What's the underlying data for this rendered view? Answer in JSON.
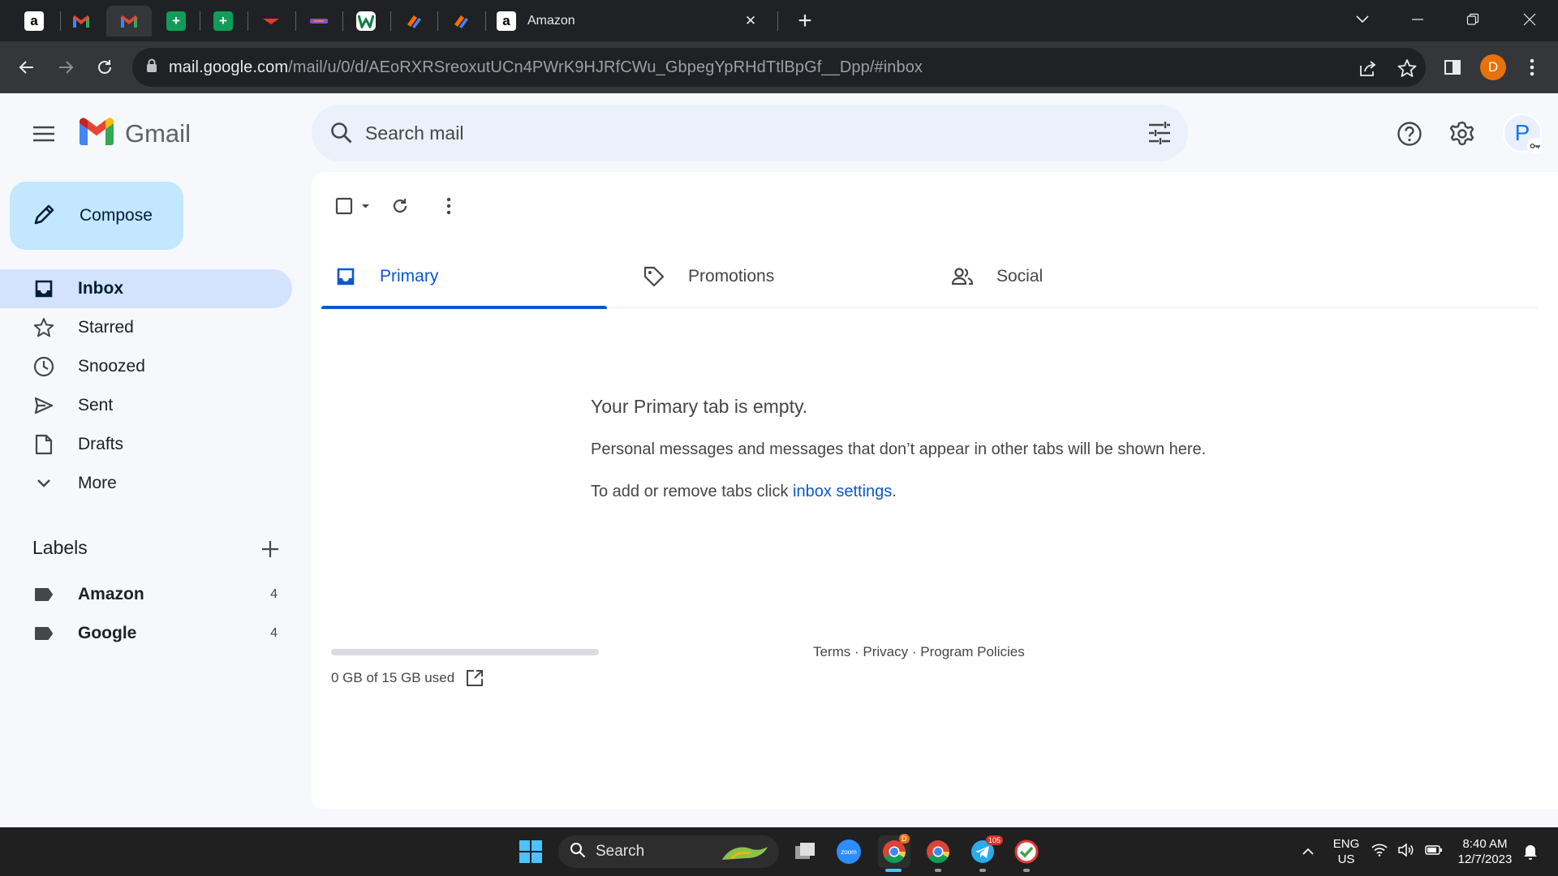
{
  "browser": {
    "active_tab_title": "Amazon",
    "url_domain": "mail.google.com",
    "url_path": "/mail/u/0/d/AEoRXRSreoxutUCn4PWrK9HJRfCWu_GbpegYpRHdTtlBpGf__Dpp/#inbox",
    "profile_initial": "D",
    "tabs": [
      {
        "icon": "amazon-icon"
      },
      {
        "icon": "gmail-icon"
      },
      {
        "icon": "gmail-icon"
      },
      {
        "icon": "google-sheets-icon"
      },
      {
        "icon": "google-sheets-icon"
      },
      {
        "icon": "site-icon"
      },
      {
        "icon": "site-icon"
      },
      {
        "icon": "w-app-icon"
      },
      {
        "icon": "task-app-icon"
      },
      {
        "icon": "task-app-icon"
      },
      {
        "icon": "amazon-icon"
      }
    ]
  },
  "gmail": {
    "logo_text": "Gmail",
    "search_placeholder": "Search mail",
    "account_initial": "P",
    "compose_label": "Compose",
    "nav": [
      {
        "label": "Inbox",
        "icon": "inbox-icon",
        "active": true
      },
      {
        "label": "Starred",
        "icon": "star-icon"
      },
      {
        "label": "Snoozed",
        "icon": "clock-icon"
      },
      {
        "label": "Sent",
        "icon": "send-icon"
      },
      {
        "label": "Drafts",
        "icon": "draft-icon"
      },
      {
        "label": "More",
        "icon": "chevron-down-icon"
      }
    ],
    "labels_title": "Labels",
    "labels": [
      {
        "name": "Amazon",
        "count": "4"
      },
      {
        "name": "Google",
        "count": "4"
      }
    ],
    "tabs": [
      {
        "label": "Primary",
        "icon": "inbox-icon",
        "active": true
      },
      {
        "label": "Promotions",
        "icon": "tag-icon"
      },
      {
        "label": "Social",
        "icon": "people-icon"
      }
    ],
    "empty": {
      "title": "Your Primary tab is empty.",
      "description": "Personal messages and messages that don’t appear in other tabs will be shown here.",
      "hint_prefix": "To add or remove tabs click ",
      "hint_link": "inbox settings",
      "hint_suffix": "."
    },
    "storage": {
      "text": "0 GB of 15 GB used",
      "used_fraction": 0
    },
    "footer": {
      "terms": "Terms",
      "privacy": "Privacy",
      "policies": "Program Policies",
      "separator": " · "
    }
  },
  "taskbar": {
    "search_label": "Search",
    "language": "ENG",
    "region": "US",
    "time": "8:40 AM",
    "date": "12/7/2023",
    "zoom_label": "zoom",
    "chrome_badge": "D",
    "telegram_badge": "105"
  },
  "colors": {
    "accent": "#0b57d0",
    "compose_bg": "#c2e7ff",
    "inbox_active_bg": "#d3e3fd",
    "search_bg": "#eaf1fb",
    "page_bg": "#f6f8fc",
    "gmail_red": "#ea4335"
  }
}
